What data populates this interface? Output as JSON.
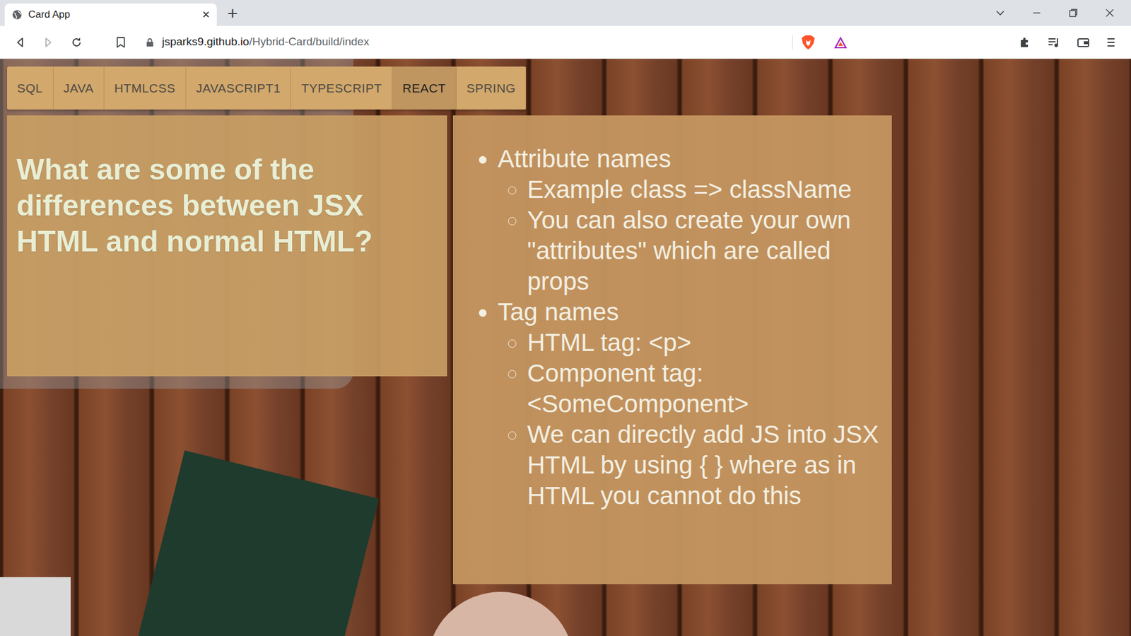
{
  "window": {
    "title": "Card App"
  },
  "browser": {
    "tab_close": "×",
    "new_tab": "+",
    "url_domain": "jsparks9.github.io",
    "url_path": "/Hybrid-Card/build/index"
  },
  "nav": {
    "tabs": [
      {
        "label": "SQL",
        "selected": false
      },
      {
        "label": "JAVA",
        "selected": false
      },
      {
        "label": "HTMLCSS",
        "selected": false
      },
      {
        "label": "JAVASCRIPT1",
        "selected": false
      },
      {
        "label": "TYPESCRIPT",
        "selected": false
      },
      {
        "label": "REACT",
        "selected": true
      },
      {
        "label": "SPRING",
        "selected": false
      }
    ]
  },
  "card": {
    "question": "What are some of the differences between JSX HTML and normal HTML?",
    "answer": [
      {
        "text": "Attribute names",
        "children": [
          "Example class => className",
          "You can also create your own \"attributes\" which are called props"
        ]
      },
      {
        "text": "Tag names",
        "children": [
          "HTML tag: <p>",
          "Component tag: <SomeComponent>",
          "We can directly add JS into JSX HTML by using { } where as in HTML you cannot do this"
        ]
      }
    ]
  }
}
